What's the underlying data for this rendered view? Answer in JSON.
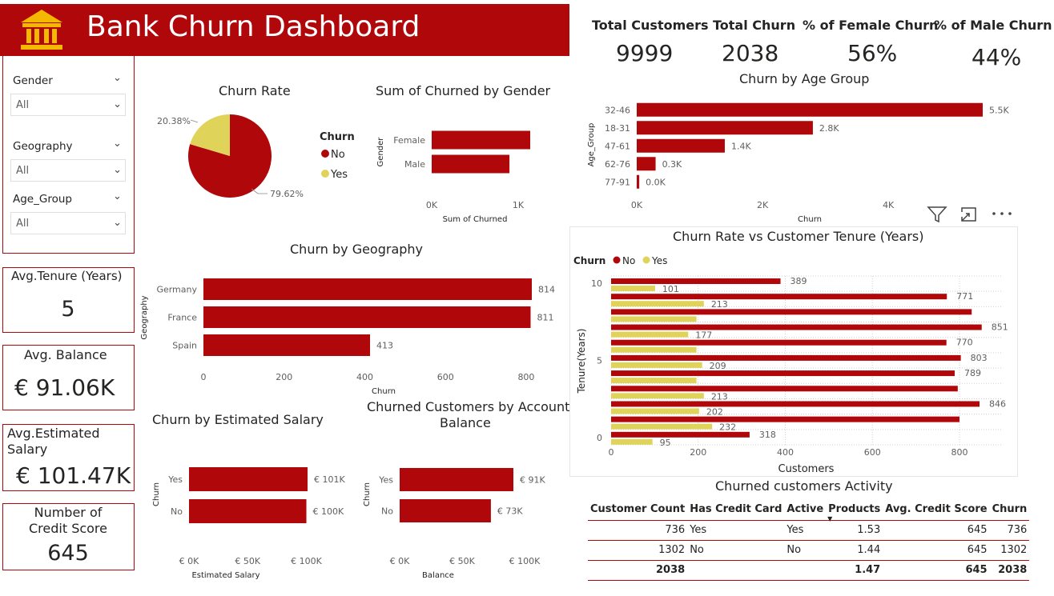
{
  "header": {
    "title": "Bank Churn Dashboard",
    "icon": "bank-icon",
    "color": "#b0070b"
  },
  "slicers": [
    {
      "label": "Gender",
      "value": "All"
    },
    {
      "label": "Geography",
      "value": "All"
    },
    {
      "label": "Age_Group",
      "value": "All"
    }
  ],
  "kpis": {
    "total_customers": {
      "label": "Total Customers",
      "value": "9999"
    },
    "total_churn": {
      "label": "Total Churn",
      "value": "2038"
    },
    "female_churn": {
      "label": "% of Female Churn",
      "value": "56%"
    },
    "male_churn": {
      "label": "% of Male Churn",
      "value": "44%"
    }
  },
  "cards": {
    "avg_tenure": {
      "label": "Avg.Tenure (Years)",
      "value": "5"
    },
    "avg_balance": {
      "label": "Avg. Balance",
      "value": "€ 91.06K"
    },
    "avg_salary": {
      "label_line1": "Avg.Estimated",
      "label_line2": "Salary",
      "value": "€ 101.47K"
    },
    "credit_score": {
      "label_line1": "Number of",
      "label_line2": "Credit Score",
      "value": "645"
    }
  },
  "visual_header_icons": [
    "filter-icon",
    "focus-mode-icon",
    "more-options-icon"
  ],
  "colors": {
    "no": "#b0070b",
    "yes": "#e0d35a",
    "accent": "#b0070b"
  },
  "chart_data": [
    {
      "id": "churn_rate",
      "type": "pie",
      "title": "Churn Rate",
      "legend_title": "Churn",
      "legend_position": "right",
      "slices": [
        {
          "name": "No",
          "value": 79.62,
          "label": "79.62%"
        },
        {
          "name": "Yes",
          "value": 20.38,
          "label": "20.38%"
        }
      ]
    },
    {
      "id": "churn_by_gender",
      "type": "bar",
      "orientation": "horizontal",
      "title": "Sum of Churned by Gender",
      "xlabel": "Sum of Churned",
      "ylabel": "Gender",
      "categories": [
        "Female",
        "Male"
      ],
      "values": [
        1139,
        899
      ],
      "xlim": [
        0,
        1000
      ],
      "xticks": [
        "0K",
        "1K"
      ]
    },
    {
      "id": "churn_by_age",
      "type": "bar",
      "orientation": "horizontal",
      "title": "Churn by Age Group",
      "xlabel": "Churn",
      "ylabel": "Age_Group",
      "categories": [
        "32-46",
        "18-31",
        "47-61",
        "62-76",
        "77-91"
      ],
      "values": [
        5500,
        2800,
        1400,
        300,
        40
      ],
      "data_labels": [
        "5.5K",
        "2.8K",
        "1.4K",
        "0.3K",
        "0.0K"
      ],
      "xticks": [
        "0K",
        "2K",
        "4K"
      ]
    },
    {
      "id": "churn_by_geography",
      "type": "bar",
      "orientation": "horizontal",
      "title": "Churn by Geography",
      "xlabel": "Churn",
      "ylabel": "Geography",
      "categories": [
        "Germany",
        "France",
        "Spain"
      ],
      "values": [
        814,
        811,
        413
      ],
      "xticks": [
        "0",
        "200",
        "400",
        "600",
        "800"
      ]
    },
    {
      "id": "churn_by_salary",
      "type": "bar",
      "orientation": "horizontal",
      "title": "Churn by Estimated Salary",
      "xlabel": "Estimated Salary",
      "ylabel": "Churn",
      "categories": [
        "Yes",
        "No"
      ],
      "values": [
        101,
        100
      ],
      "data_labels": [
        "€ 101K",
        "€ 100K"
      ],
      "xticks": [
        "€ 0K",
        "€ 50K",
        "€ 100K"
      ]
    },
    {
      "id": "churn_by_balance",
      "type": "bar",
      "orientation": "horizontal",
      "title_line1": "Churned Customers by Account",
      "title_line2": "Balance",
      "xlabel": "Balance",
      "ylabel": "Churn",
      "categories": [
        "Yes",
        "No"
      ],
      "values": [
        91,
        73
      ],
      "data_labels": [
        "€ 91K",
        "€ 73K"
      ],
      "xticks": [
        "€ 0K",
        "€ 50K",
        "€ 100K"
      ]
    },
    {
      "id": "churn_vs_tenure",
      "type": "bar",
      "orientation": "horizontal",
      "title": "Churn Rate vs Customer Tenure (Years)",
      "legend_title": "Churn",
      "legend_position": "top-left",
      "xlabel": "Customers",
      "ylabel": "Tenure(Years)",
      "categories": [
        "10",
        "9",
        "8",
        "7",
        "6",
        "5",
        "4",
        "3",
        "2",
        "1",
        "0"
      ],
      "yticks": [
        "10",
        "5",
        "0"
      ],
      "series": [
        {
          "name": "No",
          "values": [
            389,
            771,
            828,
            851,
            770,
            803,
            789,
            796,
            846,
            800,
            318
          ]
        },
        {
          "name": "Yes",
          "values": [
            101,
            213,
            196,
            177,
            196,
            209,
            196,
            213,
            202,
            232,
            95
          ]
        }
      ],
      "labeled_no": [
        true,
        true,
        false,
        true,
        true,
        true,
        true,
        false,
        true,
        false,
        true
      ],
      "labeled_yes": [
        true,
        true,
        false,
        true,
        false,
        true,
        false,
        true,
        true,
        true,
        true
      ],
      "xticks": [
        "0",
        "200",
        "400",
        "600",
        "800"
      ],
      "grid": true
    }
  ],
  "activity_table": {
    "title": "Churned customers Activity",
    "columns": [
      "Customer Count",
      "Has Credit Card",
      "Active",
      "Products",
      "Avg. Credit Score",
      "Churn"
    ],
    "sort_indicator": "▼",
    "rows": [
      [
        "736",
        "Yes",
        "Yes",
        "1.53",
        "645",
        "736"
      ],
      [
        "1302",
        "No",
        "No",
        "1.44",
        "645",
        "1302"
      ]
    ],
    "total": [
      "2038",
      "",
      "",
      "1.47",
      "645",
      "2038"
    ]
  }
}
